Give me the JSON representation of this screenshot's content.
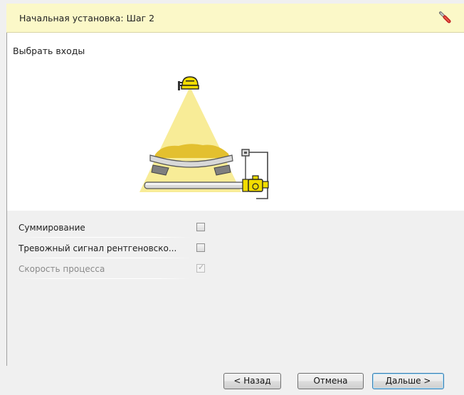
{
  "header": {
    "title": "Начальная установка: Шаг 2",
    "icon": "wrench-icon"
  },
  "main": {
    "section_label": "Выбрать входы",
    "options": [
      {
        "label": "Суммирование",
        "checked": false,
        "enabled": true
      },
      {
        "label": "Тревожный сигнал рентгеновско...",
        "checked": false,
        "enabled": true
      },
      {
        "label": "Скорость процесса",
        "checked": true,
        "enabled": false
      }
    ]
  },
  "footer": {
    "back_label": "< Назад",
    "cancel_label": "Отмена",
    "next_label": "Дальше >"
  },
  "colors": {
    "header_bg": "#fbf8c8",
    "beam": "#f7ea8c",
    "material": "#e3c02f",
    "accent_yellow": "#f2dc00"
  }
}
